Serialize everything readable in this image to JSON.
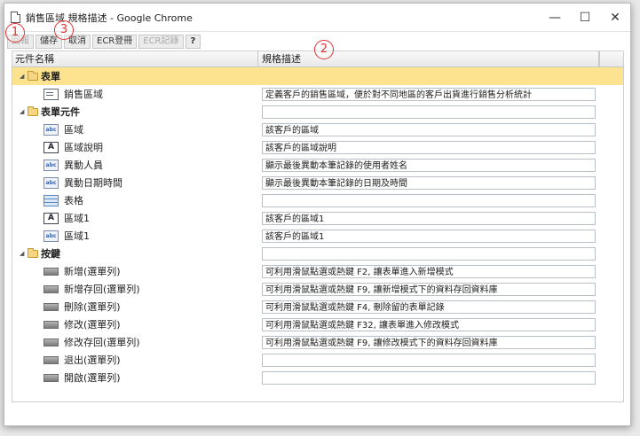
{
  "window": {
    "title": "銷售區域 規格描述 - Google Chrome",
    "minimize": "—",
    "maximize": "☐",
    "close": "✕"
  },
  "toolbar": [
    {
      "label": "回報",
      "disabled": true
    },
    {
      "label": "儲存",
      "disabled": false
    },
    {
      "label": "取消",
      "disabled": false
    },
    {
      "label": "ECR登冊",
      "disabled": false
    },
    {
      "label": "ECR記錄",
      "disabled": true
    },
    {
      "label": "?",
      "disabled": false
    }
  ],
  "grid": {
    "col1_header": "元件名稱",
    "col2_header": "規格描述"
  },
  "groups": [
    {
      "label": "表單",
      "items": [
        {
          "label": "銷售區域",
          "icon": "form-icon",
          "desc": "定義客戶的銷售區域，便於對不同地區的客戶出貨進行銷售分析統計"
        }
      ]
    },
    {
      "label": "表單元件",
      "items": [
        {
          "label": "區域",
          "icon": "textbox-icon",
          "desc": "該客戶的區域"
        },
        {
          "label": "區域說明",
          "icon": "label-icon",
          "desc": "該客戶的區域說明"
        },
        {
          "label": "異動人員",
          "icon": "textbox-icon",
          "desc": "顯示最後異動本筆記錄的使用者姓名"
        },
        {
          "label": "異動日期時間",
          "icon": "textbox-icon",
          "desc": "顯示最後異動本筆記錄的日期及時間"
        },
        {
          "label": "表格",
          "icon": "table-icon",
          "desc": ""
        },
        {
          "label": "區域1",
          "icon": "label-icon",
          "desc": "該客戶的區域1"
        },
        {
          "label": "區域1",
          "icon": "textbox-icon",
          "desc": "該客戶的區域1"
        }
      ]
    },
    {
      "label": "按鍵",
      "items": [
        {
          "label": "新增(選單列)",
          "icon": "button-icon",
          "desc": "可利用滑鼠點選或熱鍵 F2, 讓表單進入新增模式"
        },
        {
          "label": "新增存回(選單列)",
          "icon": "button-icon",
          "desc": "可利用滑鼠點選或熱鍵 F9, 讓新增模式下的資料存回資料庫"
        },
        {
          "label": "刪除(選單列)",
          "icon": "button-icon",
          "desc": "可利用滑鼠點選或熱鍵 F4, 刪除留的表單記錄"
        },
        {
          "label": "修改(選單列)",
          "icon": "button-icon",
          "desc": "可利用滑鼠點選或熱鍵 F32, 讓表單進入修改模式"
        },
        {
          "label": "修改存回(選單列)",
          "icon": "button-icon",
          "desc": "可利用滑鼠點選或熱鍵 F9, 讓修改模式下的資料存回資料庫"
        },
        {
          "label": "退出(選單列)",
          "icon": "button-icon",
          "desc": ""
        },
        {
          "label": "開啟(選單列)",
          "icon": "button-icon",
          "desc": ""
        }
      ]
    }
  ],
  "markers": [
    "1",
    "2",
    "3"
  ],
  "colors": {
    "group_highlight": "#fde38f",
    "marker": "#dd3333"
  }
}
